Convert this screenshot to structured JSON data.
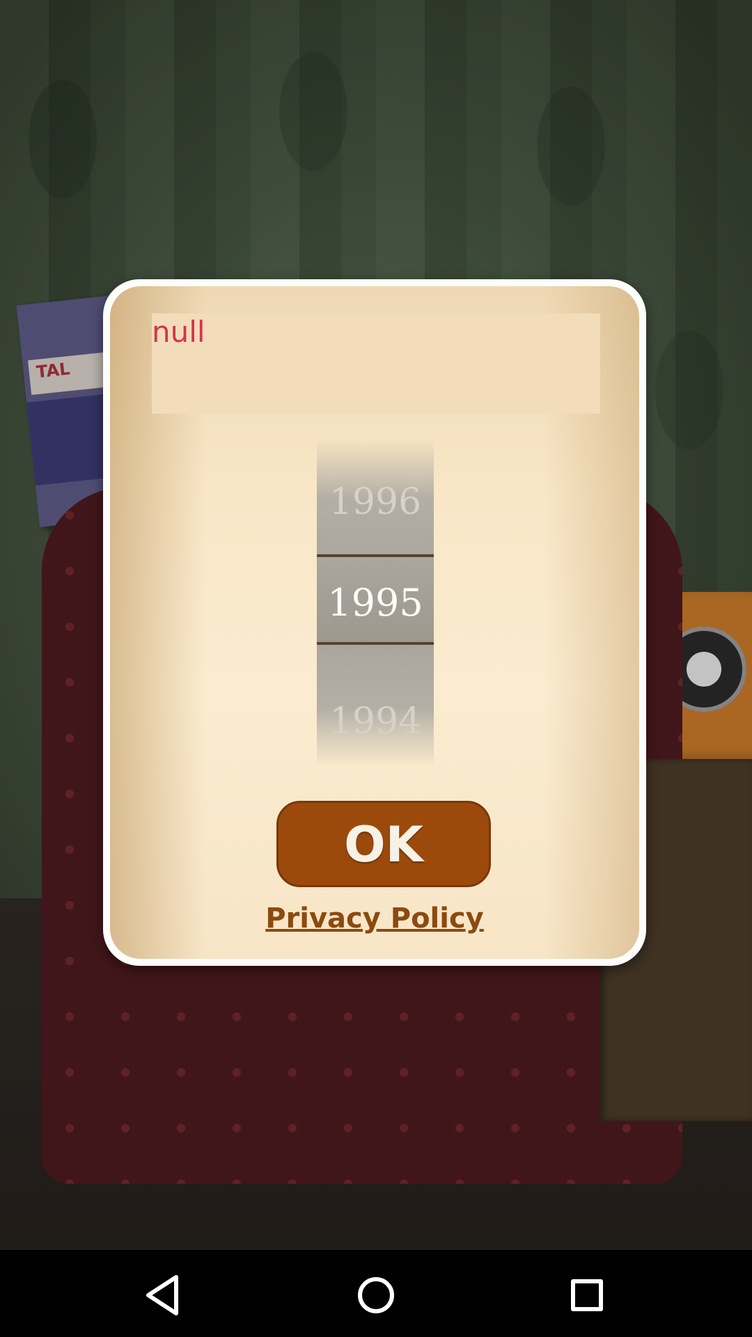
{
  "dialog": {
    "title": "null",
    "year_picker": {
      "previous": "1996",
      "selected": "1995",
      "next": "1994"
    },
    "ok_label": "OK",
    "privacy_label": "Privacy Policy"
  },
  "background": {
    "magazine_label": "TAL"
  },
  "navbar": {
    "back_icon": "triangle-back-icon",
    "home_icon": "circle-home-icon",
    "recent_icon": "square-recent-apps-icon"
  },
  "colors": {
    "title_text": "#d6334e",
    "ok_button": "#9c4a0c",
    "privacy_link": "#8b4a10",
    "dialog_bg": "#f8e6c6"
  }
}
